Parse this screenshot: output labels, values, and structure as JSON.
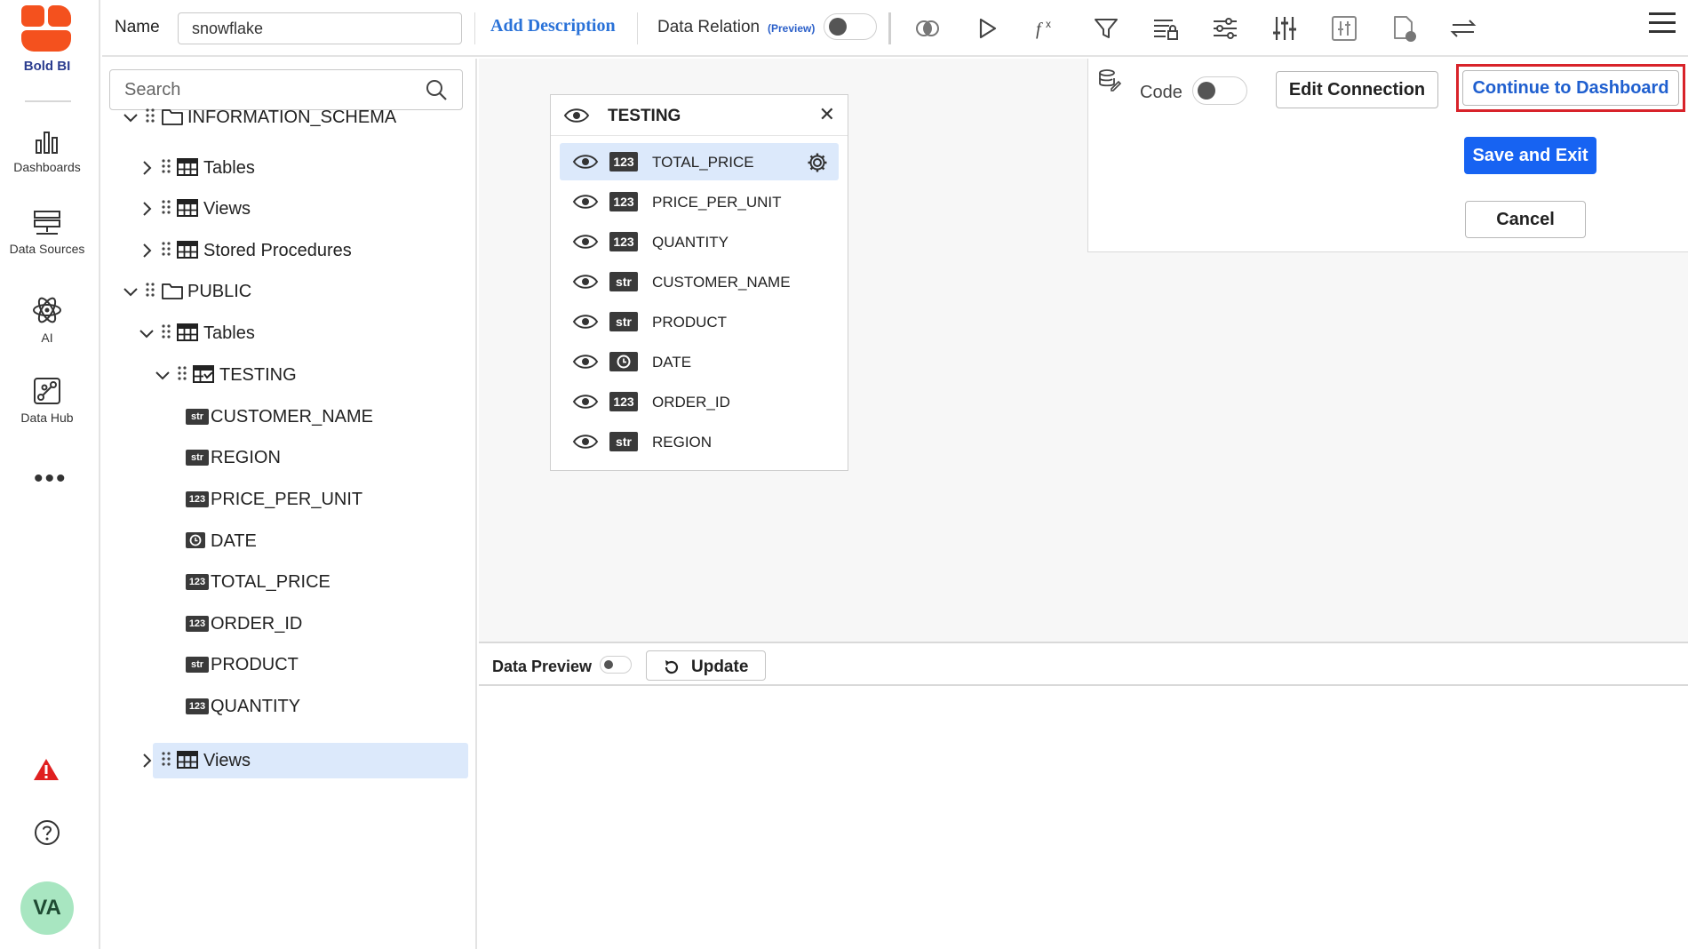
{
  "app": {
    "brand": "Bold BI",
    "user_initials": "VA"
  },
  "nav": {
    "items": [
      {
        "label": "Dashboards",
        "icon": "bar-chart-icon"
      },
      {
        "label": "Data Sources",
        "icon": "server-icon"
      },
      {
        "label": "AI",
        "icon": "atom-icon"
      },
      {
        "label": "Data Hub",
        "icon": "data-hub-icon"
      }
    ]
  },
  "toolbar": {
    "name_label": "Name",
    "name_value": "snowflake",
    "add_description": "Add Description",
    "data_relation": "Data Relation",
    "preview_tag": "(Preview)",
    "data_relation_on": false,
    "icons": [
      "join-icon",
      "run-icon",
      "expression-icon",
      "filter-icon",
      "table-lock-icon",
      "settings-sliders-icon",
      "equalizer-icon",
      "column-settings-icon",
      "document-status-icon",
      "switch-arrows-icon",
      "hamburger-menu-icon"
    ]
  },
  "schema": {
    "search_placeholder": "Search",
    "tree": [
      {
        "label": "INFORMATION_SCHEMA",
        "level": 0,
        "kind": "folder",
        "expanded": true
      },
      {
        "label": "Tables",
        "level": 1,
        "kind": "table-group",
        "expanded": false
      },
      {
        "label": "Views",
        "level": 1,
        "kind": "table-group",
        "expanded": false
      },
      {
        "label": "Stored Procedures",
        "level": 1,
        "kind": "table-group",
        "expanded": false
      },
      {
        "label": "PUBLIC",
        "level": 0,
        "kind": "folder",
        "expanded": true
      },
      {
        "label": "Tables",
        "level": 1,
        "kind": "table-group",
        "expanded": true
      },
      {
        "label": "TESTING",
        "level": 2,
        "kind": "table",
        "expanded": true
      },
      {
        "label": "CUSTOMER_NAME",
        "level": 3,
        "kind": "column",
        "type": "str"
      },
      {
        "label": "REGION",
        "level": 3,
        "kind": "column",
        "type": "str"
      },
      {
        "label": "PRICE_PER_UNIT",
        "level": 3,
        "kind": "column",
        "type": "123"
      },
      {
        "label": "DATE",
        "level": 3,
        "kind": "column",
        "type": "date"
      },
      {
        "label": "TOTAL_PRICE",
        "level": 3,
        "kind": "column",
        "type": "123"
      },
      {
        "label": "ORDER_ID",
        "level": 3,
        "kind": "column",
        "type": "123"
      },
      {
        "label": "PRODUCT",
        "level": 3,
        "kind": "column",
        "type": "str"
      },
      {
        "label": "QUANTITY",
        "level": 3,
        "kind": "column",
        "type": "123"
      },
      {
        "label": "Views",
        "level": 1,
        "kind": "table-group",
        "expanded": false,
        "selected": true
      }
    ]
  },
  "table_card": {
    "title": "TESTING",
    "columns": [
      {
        "name": "TOTAL_PRICE",
        "type": "123",
        "active": true
      },
      {
        "name": "PRICE_PER_UNIT",
        "type": "123"
      },
      {
        "name": "QUANTITY",
        "type": "123"
      },
      {
        "name": "CUSTOMER_NAME",
        "type": "str"
      },
      {
        "name": "PRODUCT",
        "type": "str"
      },
      {
        "name": "DATE",
        "type": "date"
      },
      {
        "name": "ORDER_ID",
        "type": "123"
      },
      {
        "name": "REGION",
        "type": "str"
      }
    ]
  },
  "actions": {
    "code_label": "Code",
    "code_on": false,
    "edit_connection": "Edit Connection",
    "continue_dashboard": "Continue to Dashboard",
    "save_exit": "Save and Exit",
    "cancel": "Cancel"
  },
  "preview": {
    "label": "Data Preview",
    "enabled": false,
    "update": "Update"
  },
  "colors": {
    "accent": "#1763f2",
    "highlight": "#d8232a",
    "brand": "#f4511e",
    "selected_row": "#dce9fb",
    "warning": "#e02020"
  }
}
